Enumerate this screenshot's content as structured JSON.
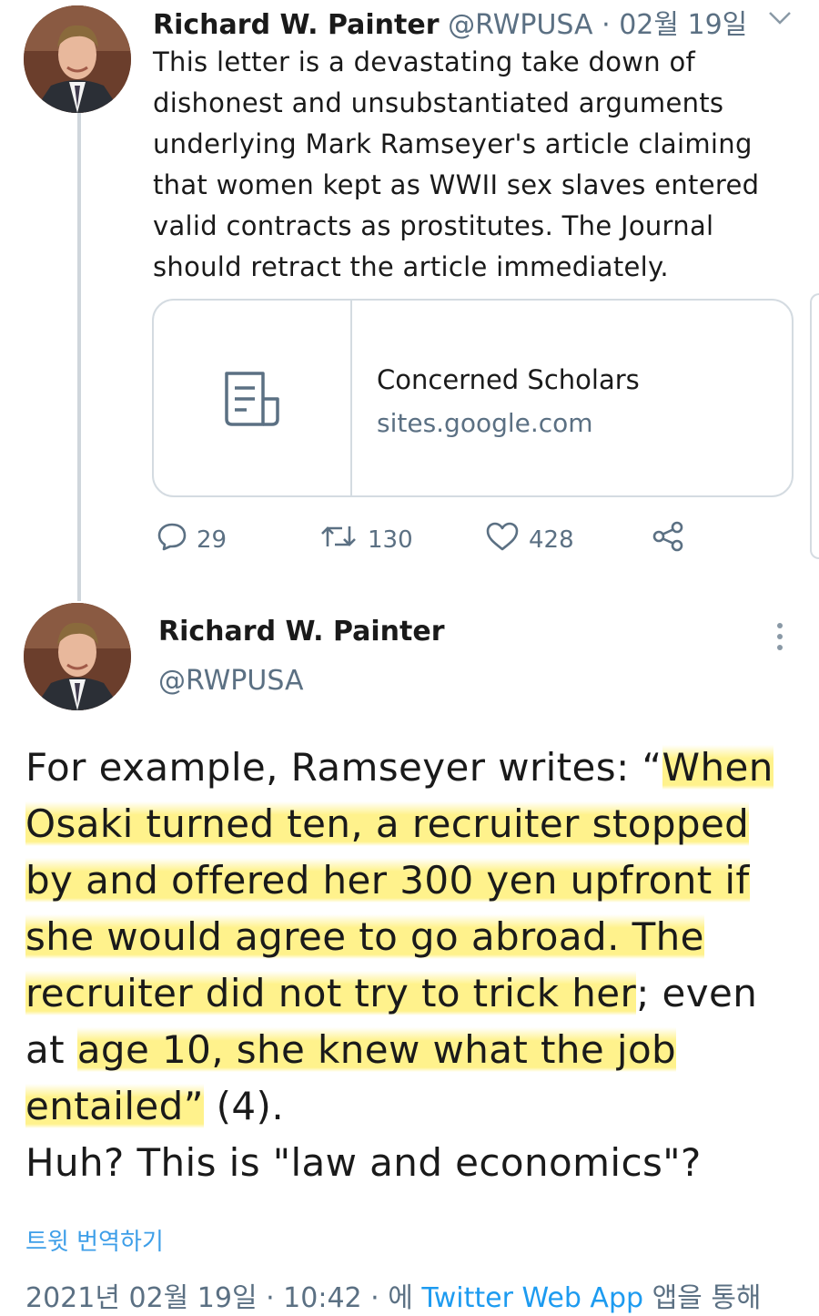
{
  "tweet1": {
    "author_name": "Richard W. Painter",
    "handle": "@RWPUSA",
    "date": "02월 19일",
    "text": "This letter is a devastating take down of dishonest and unsubstantiated arguments underlying Mark Ramseyer's article claiming that women kept as WWII sex slaves entered valid contracts as prostitutes. The Journal should retract the article immediately.",
    "card": {
      "icon": "document-icon",
      "title": "Concerned Scholars",
      "url": "sites.google.com"
    },
    "actions": {
      "replies": "29",
      "retweets": "130",
      "likes": "428"
    }
  },
  "tweet2": {
    "author_name": "Richard W. Painter",
    "handle": "@RWPUSA",
    "body": {
      "p1": "For example, Ramseyer writes: “",
      "hl1": "When Osaki turned ten, a recruiter stopped by and offered her 300 yen upfront if she would agree to go abroad. The recruiter did not try to trick her",
      "p2": "; even at ",
      "hl2": "age 10, she knew what the job entailed”",
      "p3": " (4).",
      "p4": "Huh?  This is \"law and economics\"?"
    },
    "translate_label": "트윗 번역하기",
    "footer": {
      "datetime": "2021년 02월 19일 · 10:42 · 에",
      "app": "Twitter Web App",
      "suffix": "앱을 통해"
    }
  },
  "colors": {
    "secondary_text": "#5b7083",
    "link_blue": "#1d9bf0",
    "highlight": "#fff078"
  }
}
